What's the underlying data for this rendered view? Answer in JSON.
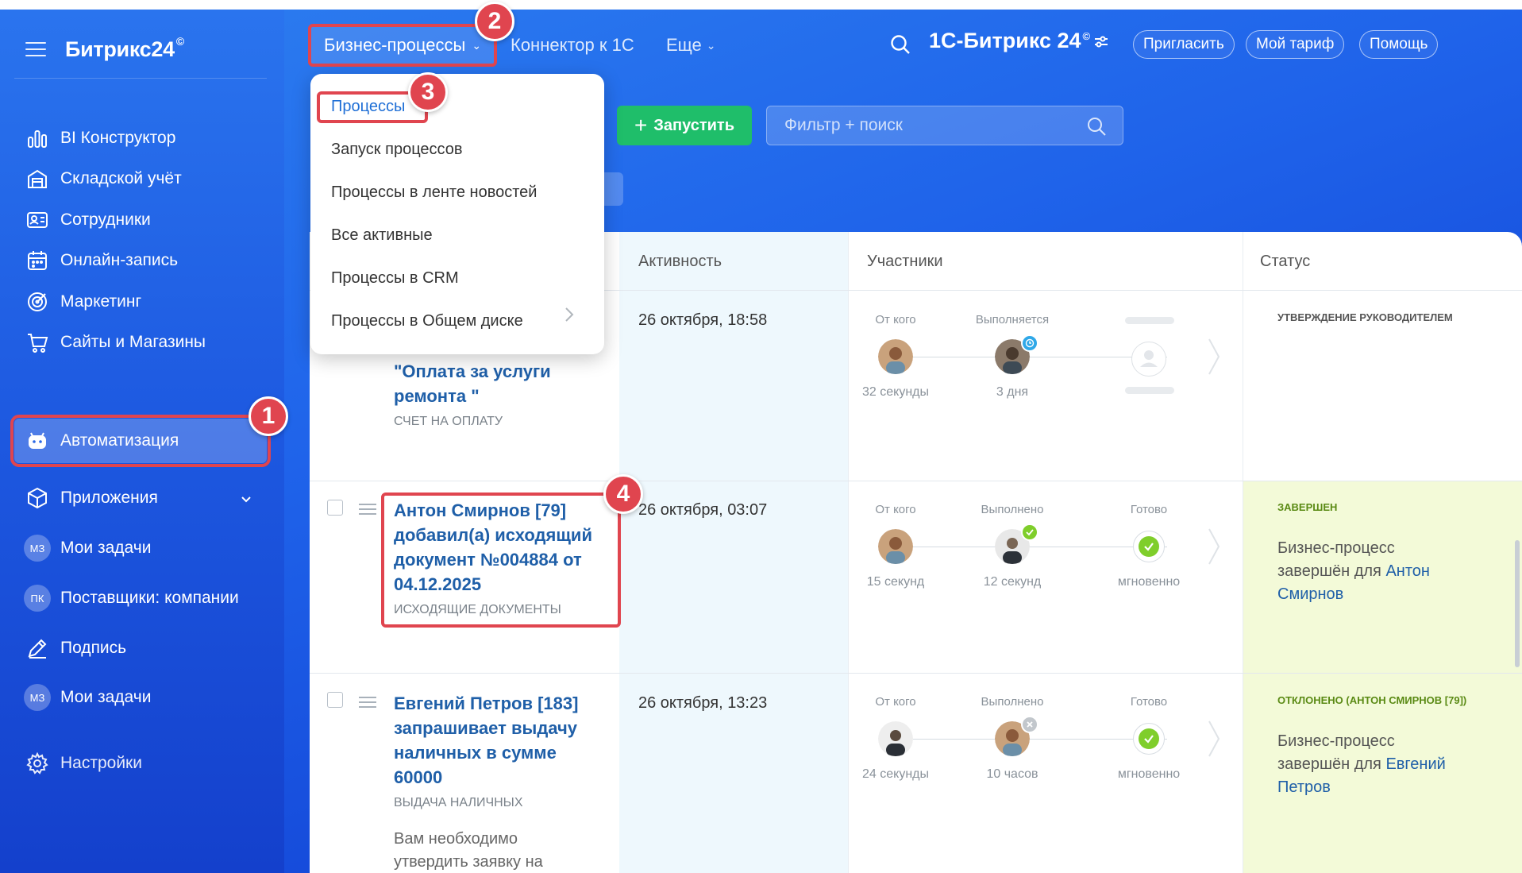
{
  "sidebar": {
    "logo": "Битрикс24",
    "logo_mark": "©",
    "items": [
      {
        "label": "BI Конструктор",
        "icon": "chart-bars-icon"
      },
      {
        "label": "Складской учёт",
        "icon": "warehouse-icon"
      },
      {
        "label": "Сотрудники",
        "icon": "id-card-icon"
      },
      {
        "label": "Онлайн-запись",
        "icon": "calendar-icon"
      },
      {
        "label": "Маркетинг",
        "icon": "target-icon"
      },
      {
        "label": "Сайты и Магазины",
        "icon": "cart-icon"
      },
      {
        "label": "Автоматизация",
        "icon": "robot-icon"
      },
      {
        "label": "Приложения",
        "icon": "cube-icon"
      },
      {
        "label": "Мои задачи",
        "avatar": "МЗ"
      },
      {
        "label": "Поставщики: компании",
        "avatar": "ПК"
      },
      {
        "label": "Подпись",
        "icon": "pen-icon"
      },
      {
        "label": "Мои задачи",
        "avatar": "МЗ"
      },
      {
        "label": "Настройки",
        "icon": "gear-icon"
      }
    ]
  },
  "topnav": {
    "business_processes": "Бизнес-процессы",
    "connector": "Коннектор к 1С",
    "more": "Еще",
    "brand": "1С-Битрикс 24",
    "brand_mark": "©",
    "invite": "Пригласить",
    "tariff": "Мой тариф",
    "help": "Помощь"
  },
  "toolbar": {
    "start_button": "Запустить",
    "filter_placeholder": "Фильтр + поиск"
  },
  "badges": [
    "1",
    "2",
    "3",
    "4"
  ],
  "dropdown": {
    "items": [
      "Процессы",
      "Запуск процессов",
      "Процессы в ленте новостей",
      "Все активные",
      "Процессы в CRM",
      "Процессы в Общем диске"
    ]
  },
  "table": {
    "headers": {
      "activity": "Активность",
      "participants": "Участники",
      "status": "Статус"
    },
    "rows": [
      {
        "title_lines": [
          "\"Оплата за услуги",
          "ремонта \""
        ],
        "type": "СЧЕТ НА ОПЛАТУ",
        "activity": "26 октября, 18:58",
        "p_from": "От кого",
        "p_from_time": "32 секунды",
        "p_mid": "Выполняется",
        "p_mid_time": "3 дня",
        "status_title": "УТВЕРЖДЕНИЕ РУКОВОДИТЕЛЕМ"
      },
      {
        "title_lines": [
          "Антон Смирнов [79]",
          "добавил(а) исходящий",
          "документ №004884 от",
          "04.12.2025"
        ],
        "type": "ИСХОДЯЩИЕ ДОКУМЕНТЫ",
        "activity": "26 октября, 03:07",
        "p_from": "От кого",
        "p_from_time": "15 секунд",
        "p_mid": "Выполнено",
        "p_mid_time": "12 секунд",
        "p_end": "Готово",
        "p_end_time": "мгновенно",
        "status_title": "ЗАВЕРШЕН",
        "status_text": "Бизнес-процесс завершён для",
        "status_name_1": "Антон",
        "status_name_2": "Смирнов"
      },
      {
        "title_lines": [
          "Евгений Петров [183]",
          "запрашивает выдачу",
          "наличных в сумме",
          "60000"
        ],
        "type": "ВЫДАЧА НАЛИЧНЫХ",
        "note_lines": [
          "Вам необходимо",
          "утвердить заявку на"
        ],
        "activity": "26 октября, 13:23",
        "p_from": "От кого",
        "p_from_time": "24 секунды",
        "p_mid": "Выполнено",
        "p_mid_time": "10 часов",
        "p_end": "Готово",
        "p_end_time": "мгновенно",
        "status_title": "ОТКЛОНЕНО (АНТОН СМИРНОВ [79])",
        "status_text": "Бизнес-процесс завершён для",
        "status_name_1": "Евгений",
        "status_name_2": "Петров"
      }
    ]
  },
  "colors": {
    "accent_green": "#1fbe6a",
    "highlight_red": "#e0454f",
    "link_blue": "#1f5fa8",
    "done_green": "#7fce2b"
  }
}
